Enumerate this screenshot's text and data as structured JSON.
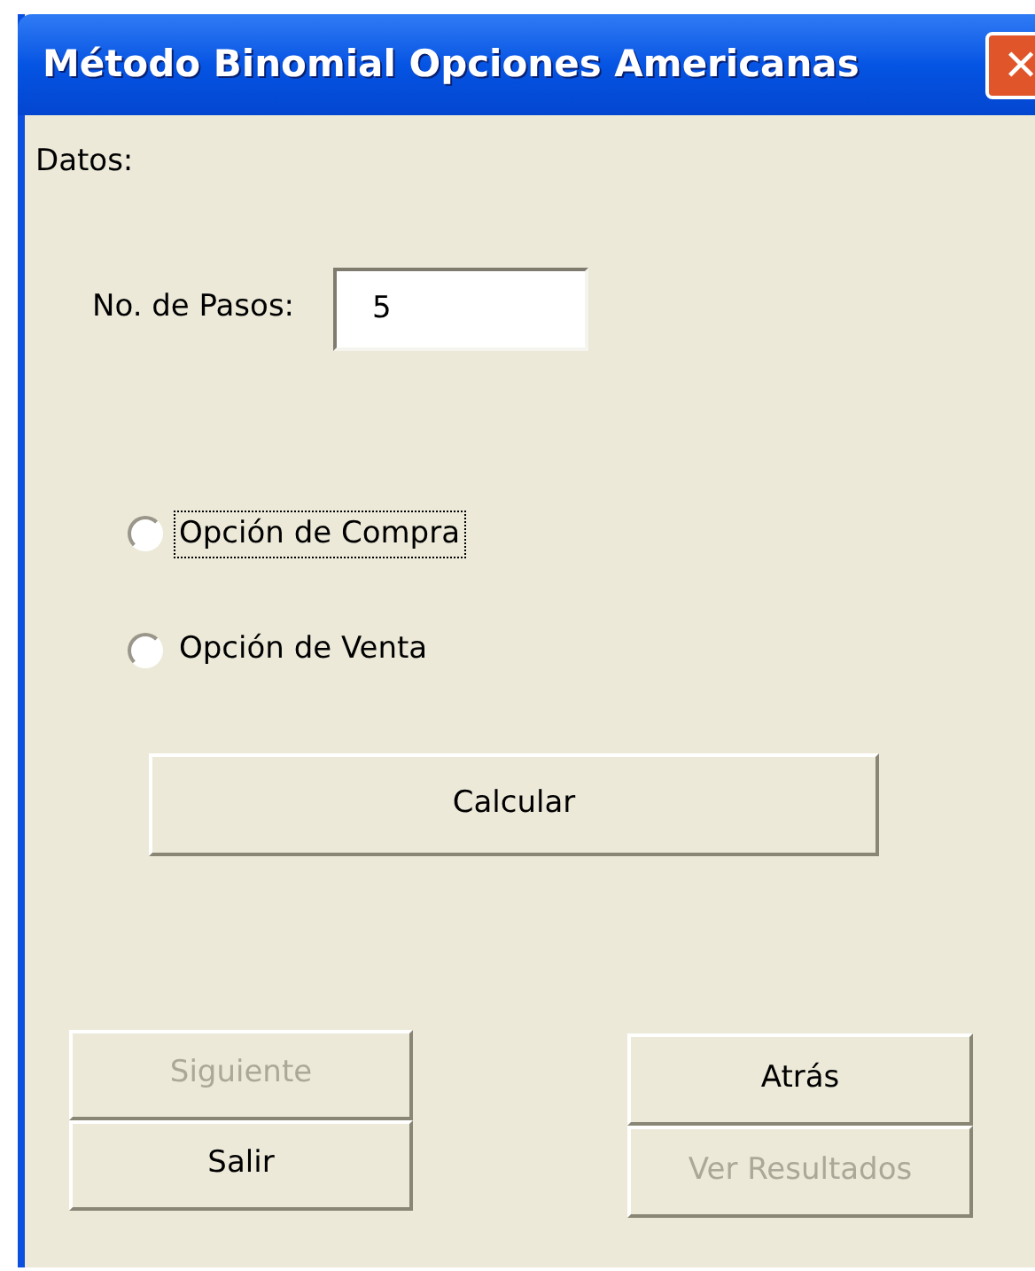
{
  "window": {
    "title": "Método Binomial Opciones Americanas",
    "close_label": "✕"
  },
  "section_label": "Datos:",
  "steps_field": {
    "label": "No. de Pasos:",
    "value": "5"
  },
  "options": [
    {
      "label": "Opción de Compra",
      "selected": false,
      "focused": true
    },
    {
      "label": "Opción de Venta",
      "selected": false,
      "focused": false
    }
  ],
  "calculate_button": {
    "label": "Calcular",
    "disabled": false
  },
  "left_buttons": [
    {
      "label": "Siguiente",
      "disabled": true
    },
    {
      "label": "Salir",
      "disabled": false
    }
  ],
  "right_buttons": [
    {
      "label": "Atrás",
      "disabled": false
    },
    {
      "label": "Ver Resultados",
      "disabled": true
    }
  ]
}
